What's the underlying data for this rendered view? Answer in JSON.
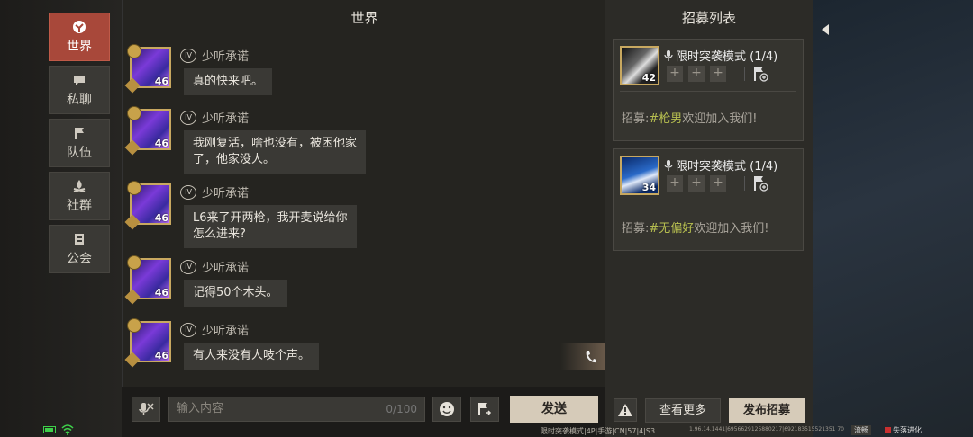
{
  "nav": {
    "items": [
      {
        "label": "世界",
        "icon": "world-icon",
        "active": true
      },
      {
        "label": "私聊",
        "icon": "chat-bubble-icon",
        "active": false
      },
      {
        "label": "队伍",
        "icon": "flag-icon",
        "active": false
      },
      {
        "label": "社群",
        "icon": "campfire-icon",
        "active": false
      },
      {
        "label": "公会",
        "icon": "guild-icon",
        "active": false
      }
    ]
  },
  "chat": {
    "title": "世界",
    "messages": [
      {
        "user": "少听承诺",
        "vip": "IV",
        "level": "46",
        "lines": [
          "真的快来吧。"
        ]
      },
      {
        "user": "少听承诺",
        "vip": "IV",
        "level": "46",
        "lines": [
          "我刚复活，啥也没有，被困他家",
          "了，他家没人。"
        ]
      },
      {
        "user": "少听承诺",
        "vip": "IV",
        "level": "46",
        "lines": [
          "L6来了开两枪，我开麦说给你",
          "怎么进来?"
        ]
      },
      {
        "user": "少听承诺",
        "vip": "IV",
        "level": "46",
        "lines": [
          "记得50个木头。"
        ]
      },
      {
        "user": "少听承诺",
        "vip": "IV",
        "level": "46",
        "lines": [
          "有人来没有人吱个声。"
        ]
      }
    ],
    "input_placeholder": "输入内容",
    "input_count": "0/100",
    "send_label": "发送"
  },
  "recruit": {
    "title": "招募列表",
    "cards": [
      {
        "mode": "限时突袭模式 (1/4)",
        "level": "42",
        "prefix": "招募:",
        "tag": "#枪男",
        "suffix": "欢迎加入我们!"
      },
      {
        "mode": "限时突袭模式 (1/4)",
        "level": "34",
        "prefix": "招募:",
        "tag": "#无偏好",
        "suffix": "欢迎加入我们!"
      }
    ],
    "more_label": "查看更多",
    "publish_label": "发布招募"
  },
  "status": {
    "server_info": "限时突袭模式|4P|手游|CN|57|4|S3",
    "build": "1.96.14.1441|6956629125880217|692183515521351 70",
    "fluency": "流畅",
    "logo_text": "失落进化"
  },
  "colors": {
    "active_tab": "#a8483a",
    "send_button": "#d6cbb9",
    "highlight_tag": "#b8c050"
  }
}
